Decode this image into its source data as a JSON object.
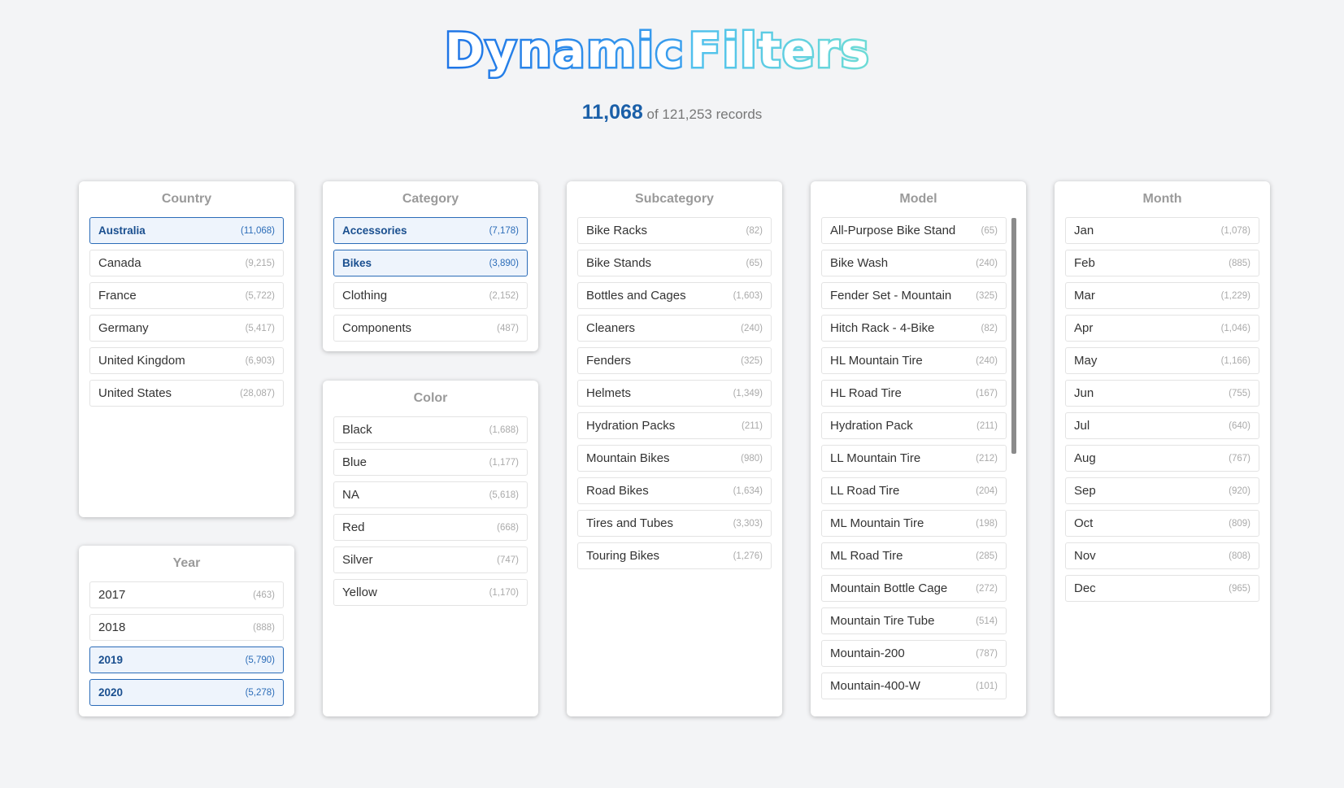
{
  "header": {
    "title_part1": "Dynamic",
    "title_part2": "Filters",
    "filtered_count": "11,068",
    "records_suffix": "of 121,253 records"
  },
  "colors": {
    "selected_border": "#2b6cb8",
    "selected_bg": "#eef4fc",
    "title_blue": "#1e74e6",
    "title_cyan": "#5fd3e0"
  },
  "panels": {
    "country": {
      "title": "Country",
      "items": [
        {
          "label": "Australia",
          "count": "(11,068)",
          "selected": true
        },
        {
          "label": "Canada",
          "count": "(9,215)",
          "selected": false
        },
        {
          "label": "France",
          "count": "(5,722)",
          "selected": false
        },
        {
          "label": "Germany",
          "count": "(5,417)",
          "selected": false
        },
        {
          "label": "United Kingdom",
          "count": "(6,903)",
          "selected": false
        },
        {
          "label": "United States",
          "count": "(28,087)",
          "selected": false
        }
      ]
    },
    "year": {
      "title": "Year",
      "items": [
        {
          "label": "2017",
          "count": "(463)",
          "selected": false
        },
        {
          "label": "2018",
          "count": "(888)",
          "selected": false
        },
        {
          "label": "2019",
          "count": "(5,790)",
          "selected": true
        },
        {
          "label": "2020",
          "count": "(5,278)",
          "selected": true
        }
      ]
    },
    "category": {
      "title": "Category",
      "items": [
        {
          "label": "Accessories",
          "count": "(7,178)",
          "selected": true
        },
        {
          "label": "Bikes",
          "count": "(3,890)",
          "selected": true
        },
        {
          "label": "Clothing",
          "count": "(2,152)",
          "selected": false
        },
        {
          "label": "Components",
          "count": "(487)",
          "selected": false
        }
      ]
    },
    "color": {
      "title": "Color",
      "items": [
        {
          "label": "Black",
          "count": "(1,688)",
          "selected": false
        },
        {
          "label": "Blue",
          "count": "(1,177)",
          "selected": false
        },
        {
          "label": "NA",
          "count": "(5,618)",
          "selected": false
        },
        {
          "label": "Red",
          "count": "(668)",
          "selected": false
        },
        {
          "label": "Silver",
          "count": "(747)",
          "selected": false
        },
        {
          "label": "Yellow",
          "count": "(1,170)",
          "selected": false
        }
      ]
    },
    "subcategory": {
      "title": "Subcategory",
      "items": [
        {
          "label": "Bike Racks",
          "count": "(82)",
          "selected": false
        },
        {
          "label": "Bike Stands",
          "count": "(65)",
          "selected": false
        },
        {
          "label": "Bottles and Cages",
          "count": "(1,603)",
          "selected": false
        },
        {
          "label": "Cleaners",
          "count": "(240)",
          "selected": false
        },
        {
          "label": "Fenders",
          "count": "(325)",
          "selected": false
        },
        {
          "label": "Helmets",
          "count": "(1,349)",
          "selected": false
        },
        {
          "label": "Hydration Packs",
          "count": "(211)",
          "selected": false
        },
        {
          "label": "Mountain Bikes",
          "count": "(980)",
          "selected": false
        },
        {
          "label": "Road Bikes",
          "count": "(1,634)",
          "selected": false
        },
        {
          "label": "Tires and Tubes",
          "count": "(3,303)",
          "selected": false
        },
        {
          "label": "Touring Bikes",
          "count": "(1,276)",
          "selected": false
        }
      ]
    },
    "model": {
      "title": "Model",
      "items": [
        {
          "label": "All-Purpose Bike Stand",
          "count": "(65)",
          "selected": false
        },
        {
          "label": "Bike Wash",
          "count": "(240)",
          "selected": false
        },
        {
          "label": "Fender Set - Mountain",
          "count": "(325)",
          "selected": false
        },
        {
          "label": "Hitch Rack - 4-Bike",
          "count": "(82)",
          "selected": false
        },
        {
          "label": "HL Mountain Tire",
          "count": "(240)",
          "selected": false
        },
        {
          "label": "HL Road Tire",
          "count": "(167)",
          "selected": false
        },
        {
          "label": "Hydration Pack",
          "count": "(211)",
          "selected": false
        },
        {
          "label": "LL Mountain Tire",
          "count": "(212)",
          "selected": false
        },
        {
          "label": "LL Road Tire",
          "count": "(204)",
          "selected": false
        },
        {
          "label": "ML Mountain Tire",
          "count": "(198)",
          "selected": false
        },
        {
          "label": "ML Road Tire",
          "count": "(285)",
          "selected": false
        },
        {
          "label": "Mountain Bottle Cage",
          "count": "(272)",
          "selected": false
        },
        {
          "label": "Mountain Tire Tube",
          "count": "(514)",
          "selected": false
        },
        {
          "label": "Mountain-200",
          "count": "(787)",
          "selected": false
        },
        {
          "label": "Mountain-400-W",
          "count": "(101)",
          "selected": false
        }
      ]
    },
    "month": {
      "title": "Month",
      "items": [
        {
          "label": "Jan",
          "count": "(1,078)",
          "selected": false
        },
        {
          "label": "Feb",
          "count": "(885)",
          "selected": false
        },
        {
          "label": "Mar",
          "count": "(1,229)",
          "selected": false
        },
        {
          "label": "Apr",
          "count": "(1,046)",
          "selected": false
        },
        {
          "label": "May",
          "count": "(1,166)",
          "selected": false
        },
        {
          "label": "Jun",
          "count": "(755)",
          "selected": false
        },
        {
          "label": "Jul",
          "count": "(640)",
          "selected": false
        },
        {
          "label": "Aug",
          "count": "(767)",
          "selected": false
        },
        {
          "label": "Sep",
          "count": "(920)",
          "selected": false
        },
        {
          "label": "Oct",
          "count": "(809)",
          "selected": false
        },
        {
          "label": "Nov",
          "count": "(808)",
          "selected": false
        },
        {
          "label": "Dec",
          "count": "(965)",
          "selected": false
        }
      ]
    }
  }
}
